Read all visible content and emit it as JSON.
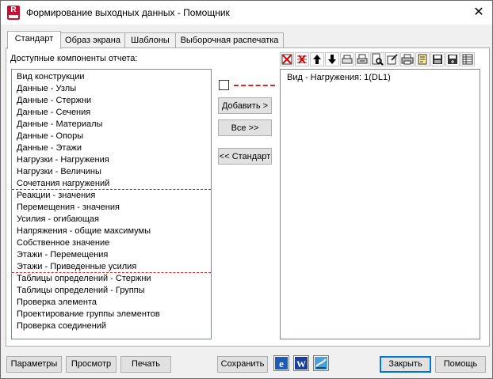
{
  "window": {
    "title": "Формирование выходных данных - Помощник",
    "app_icon_letter": "R"
  },
  "tabs": [
    {
      "label": "Стандарт",
      "active": true
    },
    {
      "label": "Образ экрана",
      "active": false
    },
    {
      "label": "Шаблоны",
      "active": false
    },
    {
      "label": "Выборочная распечатка",
      "active": false
    }
  ],
  "available": {
    "label": "Доступные компоненты отчета:",
    "items": [
      "Вид конструкции",
      "Данные - Узлы",
      "Данные - Стержни",
      "Данные - Сечения",
      "Данные - Материалы",
      "Данные - Опоры",
      "Данные - Этажи",
      "Нагрузки - Нагружения",
      "Нагрузки - Величины",
      "Сочетания нагружений",
      "Реакции - значения",
      "Перемещения - значения",
      "Усилия - огибающая",
      "Напряжения - общие максимумы",
      "Собственное значение",
      "Этажи - Перемещения",
      "Этажи - Приведенные усилия",
      "Таблицы определений - Стержни",
      "Таблицы определений - Группы",
      "Проверка элемента",
      "Проектирование группы элементов",
      "Проверка соединений"
    ]
  },
  "middle": {
    "add_label": "Добавить >",
    "all_label": "Все >>",
    "standard_label": "<< Стандарт"
  },
  "selected": {
    "items": [
      "Вид - Нагружения: 1(DL1)"
    ]
  },
  "toolbar_icons": [
    "delete-icon",
    "delete-all-icon",
    "move-up-icon",
    "move-down-icon",
    "print-setup-icon",
    "print-options-icon",
    "preview-icon",
    "edit-icon",
    "print-icon",
    "notes-icon",
    "save-template-icon",
    "load-template-icon",
    "table-icon"
  ],
  "footer": {
    "params_label": "Параметры",
    "preview_label": "Просмотр",
    "print_label": "Печать",
    "save_label": "Сохранить",
    "close_label": "Закрыть",
    "help_label": "Помощь"
  },
  "colors": {
    "separator": "#d42b2b",
    "accent": "#0078d7",
    "brand": "#c8102e"
  }
}
